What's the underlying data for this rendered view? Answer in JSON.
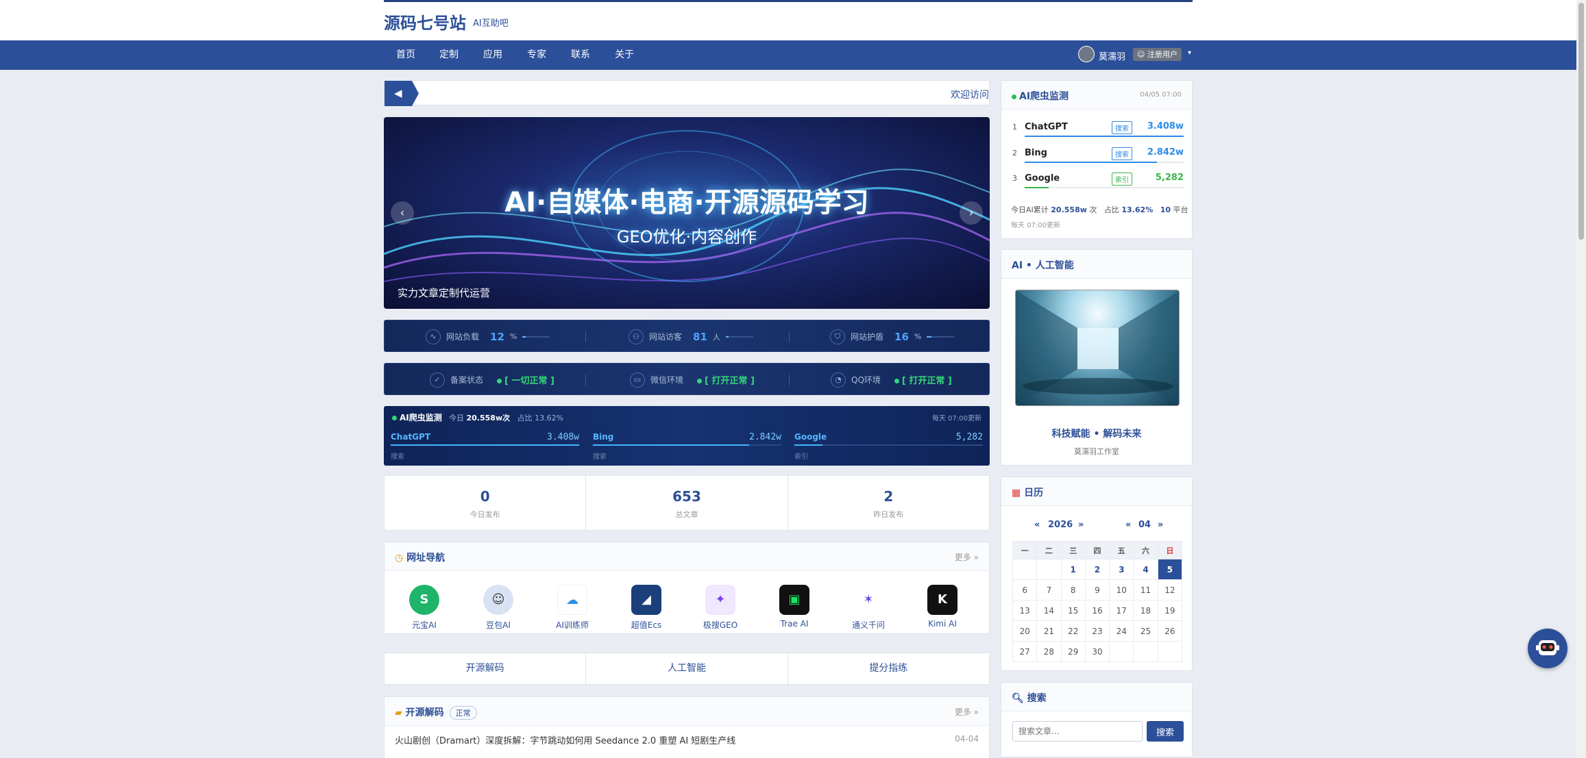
{
  "header": {
    "logo": "源码七号站",
    "subtitle": "AI互助吧"
  },
  "nav": {
    "items": [
      "首页",
      "定制",
      "应用",
      "专家",
      "联系",
      "关于"
    ],
    "user_name": "莫濡羽",
    "user_badge": "注册用户"
  },
  "announcement": {
    "text": "欢迎访问"
  },
  "banner": {
    "title": "AI·自媒体·电商·开源源码学习",
    "subtitle": "GEO优化·内容创作",
    "caption": "实力文章定制代运营",
    "prev": "‹",
    "next": "›"
  },
  "status_row1": [
    {
      "label": "网站负载",
      "value": "12",
      "unit": "%",
      "fraction": 0.12
    },
    {
      "label": "网站访客",
      "value": "81",
      "unit": "人",
      "fraction": 0.1
    },
    {
      "label": "网站护盾",
      "value": "16",
      "unit": "%",
      "fraction": 0.16
    }
  ],
  "status_row2": [
    {
      "label": "备案状态",
      "value": "[ 一切正常 ]"
    },
    {
      "label": "微信环境",
      "value": "[ 打开正常 ]"
    },
    {
      "label": "QQ环境",
      "value": "[ 打开正常 ]"
    }
  ],
  "monitor": {
    "title": "AI爬虫监测",
    "today_label": "今日",
    "today_value": "20.558w次",
    "ratio": "占比 13.62%",
    "time": "每天 07:00更新",
    "items": [
      {
        "name": "ChatGPT",
        "value": "3.408w",
        "tag": "搜索",
        "fraction": 1.0
      },
      {
        "name": "Bing",
        "value": "2.842w",
        "tag": "搜索",
        "fraction": 0.83
      },
      {
        "name": "Google",
        "value": "5,282",
        "tag": "索引",
        "fraction": 0.15
      }
    ]
  },
  "stats": [
    {
      "num": "0",
      "label": "今日发布"
    },
    {
      "num": "653",
      "label": "总文章"
    },
    {
      "num": "2",
      "label": "昨日发布"
    }
  ],
  "links": {
    "title": "网址导航",
    "more": "更多 »",
    "items": [
      "元宝AI",
      "豆包AI",
      "AI训练师",
      "超值Ecs",
      "极搜GEO",
      "Trae AI",
      "通义千问",
      "Kimi AI"
    ]
  },
  "tabs": [
    "开源解码",
    "人工智能",
    "提分指练"
  ],
  "oss": {
    "title": "开源解码",
    "badge": "正常",
    "more": "更多 »",
    "rows": [
      {
        "title": "火山剧创（Dramart）深度拆解：字节跳动如何用 Seedance 2.0 重塑 AI 短剧生产线",
        "date": "04-04"
      }
    ]
  },
  "side_monitor": {
    "title": "AI爬虫监测",
    "time": "04/05 07:00",
    "items": [
      {
        "n": "1",
        "name": "ChatGPT",
        "tag": "搜索",
        "value": "3.408w",
        "fraction": 1.0,
        "color": "#2e8be6"
      },
      {
        "n": "2",
        "name": "Bing",
        "tag": "搜索",
        "value": "2.842w",
        "fraction": 0.83,
        "color": "#2e8be6"
      },
      {
        "n": "3",
        "name": "Google",
        "tag": "索引",
        "value": "5,282",
        "fraction": 0.15,
        "color": "#3bb54a"
      }
    ],
    "sum_pre": "今日AI累计",
    "sum_value": "20.558w",
    "sum_unit": "次",
    "sum_ratio_label": "占比",
    "sum_ratio": "13.62%",
    "sum_platforms": "10",
    "sum_platform_label": "平台",
    "note": "每天 07:00更新"
  },
  "ai_card": {
    "title": "AI • 人工智能",
    "caption": "科技赋能 • 解码未来",
    "sub": "莫濡羽工作室"
  },
  "calendar": {
    "title": "日历",
    "year": "2026",
    "month": "04",
    "prev": "«",
    "next": "»",
    "weekdays": [
      "一",
      "二",
      "三",
      "四",
      "五",
      "六",
      "日"
    ],
    "weeks": [
      [
        "",
        "",
        "1",
        "2",
        "3",
        "4",
        "5"
      ],
      [
        "6",
        "7",
        "8",
        "9",
        "10",
        "11",
        "12"
      ],
      [
        "13",
        "14",
        "15",
        "16",
        "17",
        "18",
        "19"
      ],
      [
        "20",
        "21",
        "22",
        "23",
        "24",
        "25",
        "26"
      ],
      [
        "27",
        "28",
        "29",
        "30",
        "",
        "",
        ""
      ]
    ],
    "today": "5"
  },
  "search": {
    "title": "搜索",
    "placeholder": "搜索文章...",
    "button": "搜索"
  },
  "colors": {
    "brand": "#2c4f99",
    "accent": "#4ea3ff",
    "ok": "#34d77a"
  }
}
